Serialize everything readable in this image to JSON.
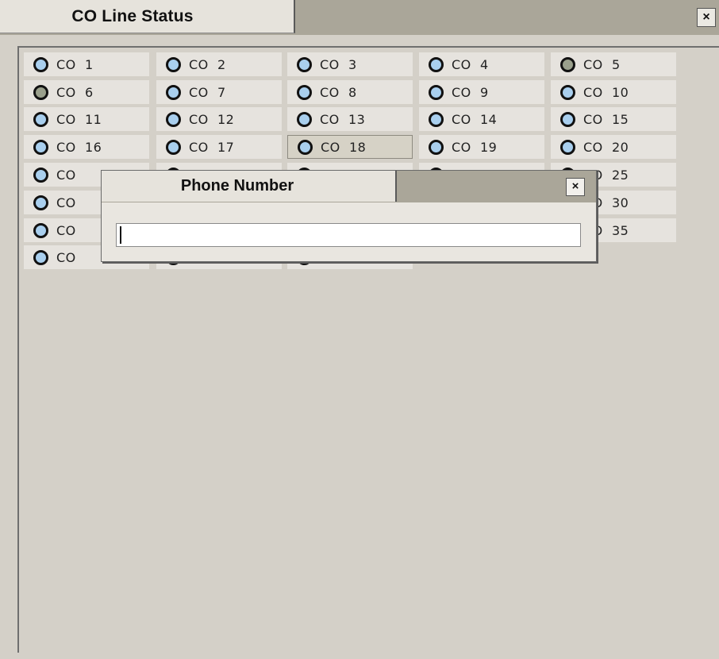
{
  "main_window": {
    "title": "CO Line Status",
    "close_label": "×"
  },
  "lines": [
    {
      "label": "CO  1",
      "led": "#a9cfee"
    },
    {
      "label": "CO  2",
      "led": "#a9cfee"
    },
    {
      "label": "CO  3",
      "led": "#a9cfee"
    },
    {
      "label": "CO  4",
      "led": "#a9cfee"
    },
    {
      "label": "CO  5",
      "led": "#9aa08c"
    },
    {
      "label": "CO  6",
      "led": "#9aa08c"
    },
    {
      "label": "CO  7",
      "led": "#a9cfee"
    },
    {
      "label": "CO  8",
      "led": "#a9cfee"
    },
    {
      "label": "CO  9",
      "led": "#a9cfee"
    },
    {
      "label": "CO  10",
      "led": "#a9cfee"
    },
    {
      "label": "CO  11",
      "led": "#a9cfee"
    },
    {
      "label": "CO  12",
      "led": "#a9cfee"
    },
    {
      "label": "CO  13",
      "led": "#a9cfee"
    },
    {
      "label": "CO  14",
      "led": "#a9cfee"
    },
    {
      "label": "CO  15",
      "led": "#a9cfee"
    },
    {
      "label": "CO  16",
      "led": "#a9cfee"
    },
    {
      "label": "CO  17",
      "led": "#a9cfee"
    },
    {
      "label": "CO  18",
      "led": "#a9cfee",
      "selected": true
    },
    {
      "label": "CO  19",
      "led": "#a9cfee"
    },
    {
      "label": "CO  20",
      "led": "#a9cfee"
    },
    {
      "label": "CO",
      "led": "#a9cfee"
    },
    {
      "label": "",
      "led": "#a9cfee"
    },
    {
      "label": "",
      "led": "#a9cfee"
    },
    {
      "label": "",
      "led": "#a9cfee"
    },
    {
      "label": "CO  25",
      "led": "#a9cfee"
    },
    {
      "label": "CO",
      "led": "#a9cfee"
    },
    {
      "label": "",
      "led": "#a9cfee"
    },
    {
      "label": "",
      "led": "#a9cfee"
    },
    {
      "label": "",
      "led": "#a9cfee"
    },
    {
      "label": "CO  30",
      "led": "#a9cfee"
    },
    {
      "label": "CO",
      "led": "#a9cfee"
    },
    {
      "label": "",
      "led": "#a9cfee"
    },
    {
      "label": "",
      "led": "#a9cfee"
    },
    {
      "label": "",
      "led": "#a9cfee"
    },
    {
      "label": "CO  35",
      "led": "#a9cfee"
    },
    {
      "label": "CO",
      "led": "#a9cfee"
    },
    {
      "label": "",
      "led": "#a9cfee"
    },
    {
      "label": "",
      "led": "#a9cfee"
    }
  ],
  "popup": {
    "title": "Phone Number",
    "close_label": "×",
    "input_value": ""
  }
}
